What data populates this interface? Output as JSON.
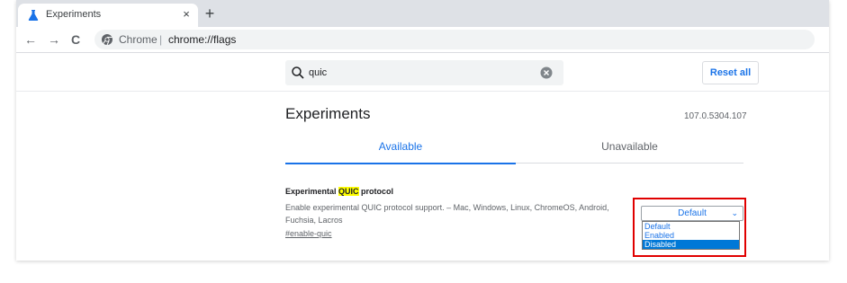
{
  "browser": {
    "tab_title": "Experiments",
    "tab_close": "×",
    "new_tab": "+",
    "nav": {
      "back": "←",
      "forward": "→",
      "reload": "C"
    },
    "omnibox": {
      "origin": "Chrome",
      "separator": "|",
      "url": "chrome://flags"
    }
  },
  "search": {
    "value": "quic"
  },
  "reset_label": "Reset all",
  "page": {
    "title": "Experiments",
    "version": "107.0.5304.107"
  },
  "tabs": [
    {
      "label": "Available",
      "active": true
    },
    {
      "label": "Unavailable",
      "active": false
    }
  ],
  "experiment": {
    "title_pre": "Experimental ",
    "title_highlight": "QUIC",
    "title_post": " protocol",
    "description": "Enable experimental QUIC protocol support. – Mac, Windows, Linux, ChromeOS, Android, Fuchsia, Lacros",
    "link": "#enable-quic",
    "select": {
      "value": "Default",
      "options": [
        "Default",
        "Enabled",
        "Disabled"
      ],
      "highlighted": "Disabled"
    }
  },
  "colors": {
    "accent": "#1a73e8",
    "highlight": "#ffff00",
    "annotation": "#e00000",
    "selected_option": "#0078d7"
  }
}
